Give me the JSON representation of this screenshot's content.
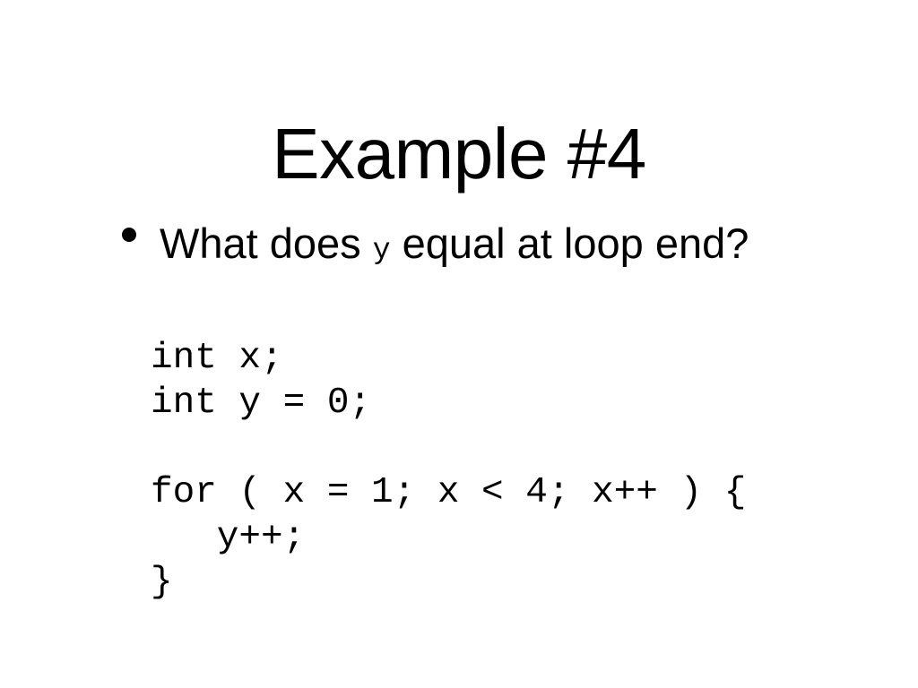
{
  "slide": {
    "title": "Example #4",
    "background_color": "#ffffff",
    "text_color": "#000000",
    "bullet": {
      "marker": "filled-circle",
      "text_before": "What does ",
      "mono_token": "y",
      "text_after": " equal at loop end?",
      "full_text": "What does y equal at loop end?"
    },
    "code": {
      "language": "c",
      "lines": [
        "int x;",
        "int y = 0;",
        "",
        "for ( x = 1; x < 4; x++ ) {",
        "   y++;",
        "}"
      ]
    }
  }
}
